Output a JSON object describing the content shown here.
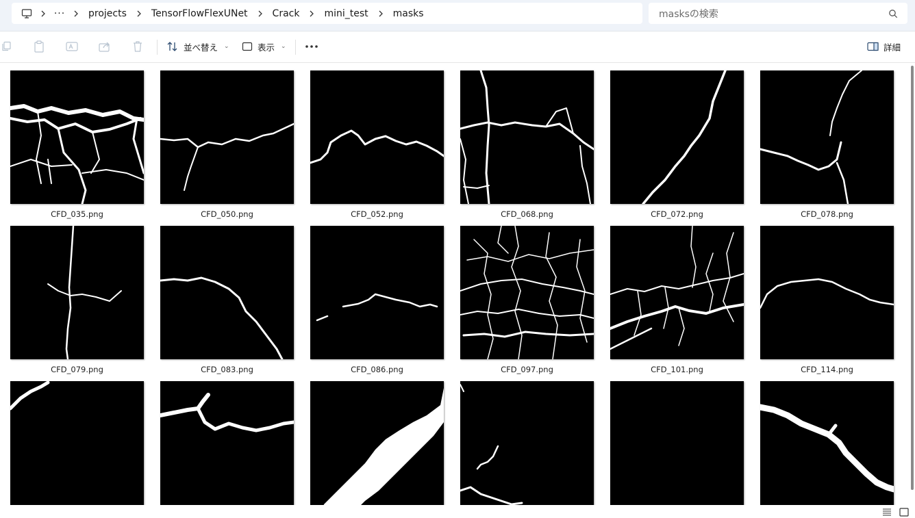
{
  "address": {
    "more": "···",
    "crumbs": [
      "projects",
      "TensorFlowFlexUNet",
      "Crack",
      "mini_test",
      "masks"
    ]
  },
  "search": {
    "placeholder": "masksの検索"
  },
  "toolbar": {
    "sort_label": "並べ替え",
    "view_label": "表示",
    "details_label": "詳細",
    "icons": [
      "copy-icon",
      "paste-icon",
      "rename-icon",
      "share-icon",
      "delete-icon",
      "sort-icon",
      "view-icon",
      "more-icon",
      "details-pane-icon"
    ]
  },
  "files": [
    {
      "name": "CFD_035.png"
    },
    {
      "name": "CFD_050.png"
    },
    {
      "name": "CFD_052.png"
    },
    {
      "name": "CFD_068.png"
    },
    {
      "name": "CFD_072.png"
    },
    {
      "name": "CFD_078.png"
    },
    {
      "name": "CFD_079.png"
    },
    {
      "name": "CFD_083.png"
    },
    {
      "name": "CFD_086.png"
    },
    {
      "name": "CFD_097.png"
    },
    {
      "name": "CFD_101.png"
    },
    {
      "name": "CFD_114.png"
    },
    {
      "name": ""
    },
    {
      "name": ""
    },
    {
      "name": ""
    },
    {
      "name": ""
    },
    {
      "name": ""
    },
    {
      "name": ""
    }
  ]
}
